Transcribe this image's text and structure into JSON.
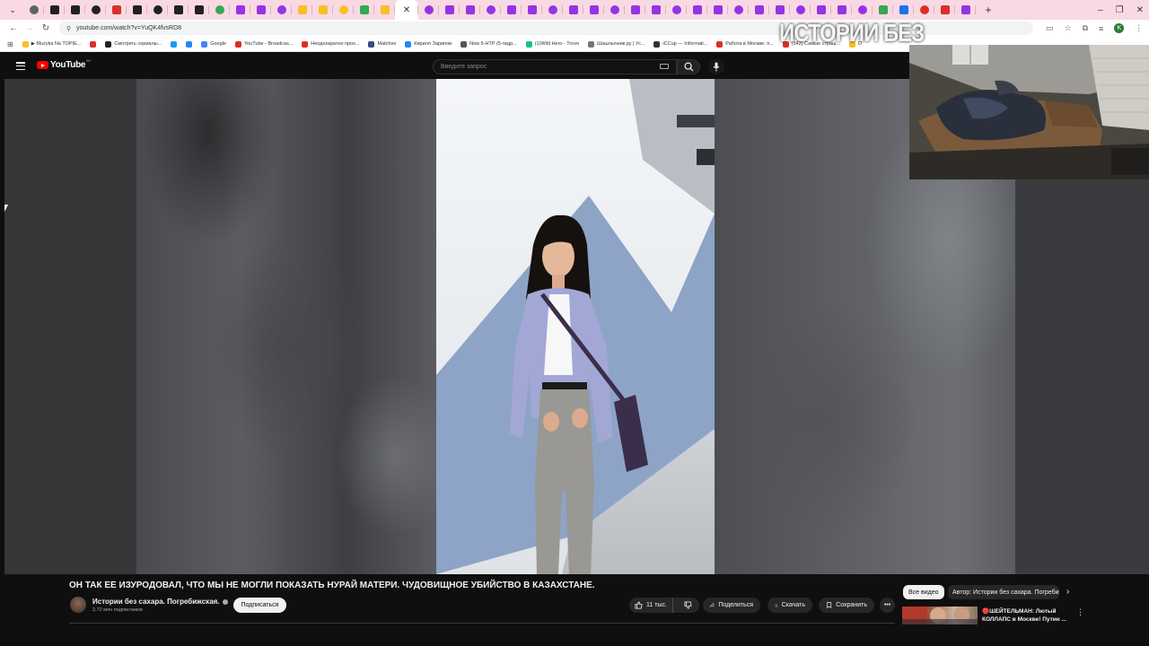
{
  "browser": {
    "url": "youtube.com/watch?v=YuQK4fvsRD8",
    "tab_favicon_colors": [
      "#5f6368",
      "#202124",
      "#202124",
      "#202124",
      "#d93025",
      "#202124",
      "#202124",
      "#202124",
      "#202124",
      "#34a853",
      "#9334e6",
      "#9334e6",
      "#9334e6",
      "#f6bf26",
      "#f6bf26",
      "#f6bf26",
      "#34a853",
      "#f6bf26",
      "#9334e6",
      "#9334e6",
      "#9334e6",
      "#9334e6",
      "#9334e6",
      "#9334e6",
      "#9334e6",
      "#9334e6",
      "#9334e6",
      "#9334e6",
      "#9334e6",
      "#9334e6",
      "#9334e6",
      "#9334e6",
      "#9334e6",
      "#9334e6",
      "#9334e6",
      "#9334e6",
      "#9334e6",
      "#9334e6",
      "#9334e6",
      "#9334e6",
      "#34a853",
      "#1a73e8",
      "#d93025",
      "#d93025",
      "#9334e6"
    ],
    "profile_initial": "K",
    "bookmarks": [
      {
        "label": "▶ Muzyka Na TOPIE...",
        "color": "#f6bf26"
      },
      {
        "label": "",
        "color": "#d93025"
      },
      {
        "label": "Смотреть сериалы...",
        "color": "#202124"
      },
      {
        "label": "",
        "color": "#1d9bf0"
      },
      {
        "label": "",
        "color": "#2787f5"
      },
      {
        "label": "Google",
        "color": "#4285f4"
      },
      {
        "label": "YouTube - Broadcas...",
        "color": "#d93025"
      },
      {
        "label": "Неоднократно прох...",
        "color": "#d93025"
      },
      {
        "label": "Matches",
        "color": "#3c4a8a"
      },
      {
        "label": "Кирилл Зарипов",
        "color": "#2787f5"
      },
      {
        "label": "Now 5-HTP (5-гидр...",
        "color": "#555555"
      },
      {
        "label": "(1)Wild Hero - Trovo",
        "color": "#19c37d"
      },
      {
        "label": "Шашлычник.ру | Ус...",
        "color": "#777777"
      },
      {
        "label": "iCCup — Informati...",
        "color": "#333333"
      },
      {
        "label": "Работа в Москве: п...",
        "color": "#d93025"
      },
      {
        "label": "(542) Самые страш...",
        "color": "#d93025"
      },
      {
        "label": "D",
        "color": "#f6bf26"
      }
    ]
  },
  "youtube": {
    "logo_text": "YouTube",
    "logo_country": "BY",
    "search_placeholder": "Введите запрос",
    "overlay_text": "ИСТОРИИ БЕЗ",
    "video_title": "ОН ТАК ЕЕ ИЗУРОДОВАЛ, ЧТО МЫ НЕ МОГЛИ ПОКАЗАТЬ НУРАЙ МАТЕРИ. ЧУДОВИЩНОЕ УБИЙСТВО В КАЗАХСТАНЕ.",
    "channel_name": "Истории без сахара. Погребижская.",
    "subscribers": "2,72 млн подписчиков",
    "subscribe_label": "Подписаться",
    "likes": "11 тыс.",
    "share_label": "Поделиться",
    "download_label": "Скачать",
    "save_label": "Сохранить",
    "chip_all": "Все видео",
    "chip_author": "Автор: Истории без сахара. Погребижская.",
    "rec_title": "🔴ШЕЙТЕЛЬМАН: Лютый КОЛЛАПС в Москве! Путин ..."
  }
}
